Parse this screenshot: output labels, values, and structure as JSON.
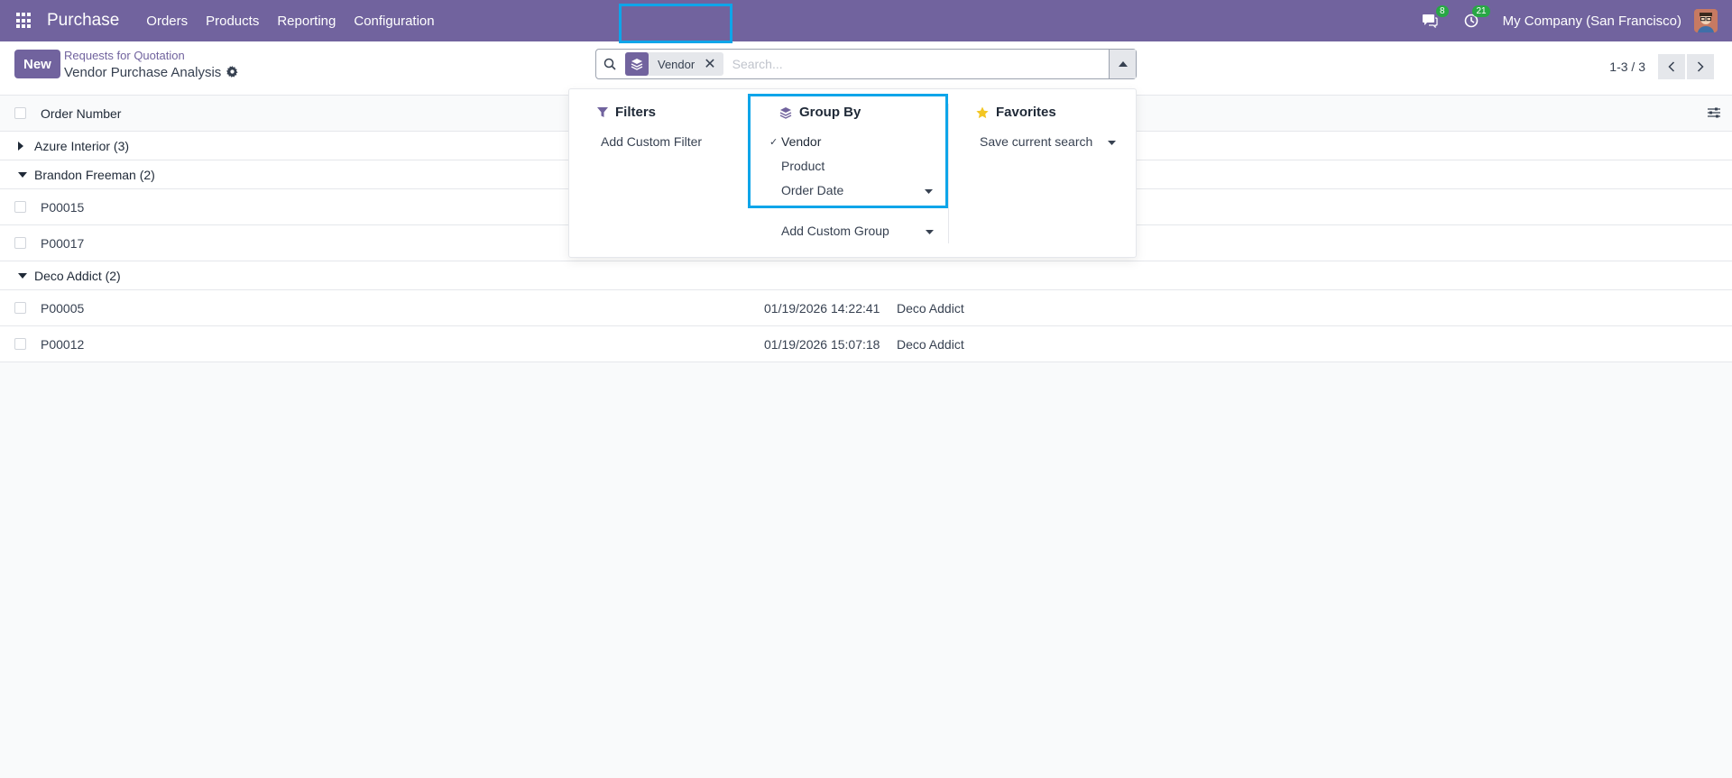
{
  "navbar": {
    "app_name": "Purchase",
    "menu": [
      "Orders",
      "Products",
      "Reporting",
      "Configuration"
    ],
    "messages_count": "8",
    "activities_count": "21",
    "company": "My Company (San Francisco)",
    "bg_color": "#71639e"
  },
  "control_panel": {
    "new_label": "New",
    "breadcrumb_parent": "Requests for Quotation",
    "breadcrumb_current": "Vendor Purchase Analysis",
    "pager_value": "1-3 / 3"
  },
  "search": {
    "facet_value": "Vendor",
    "placeholder": "Search..."
  },
  "search_panel": {
    "filters_title": "Filters",
    "add_custom_filter": "Add Custom Filter",
    "groupby_title": "Group By",
    "groupby_options": [
      {
        "label": "Vendor",
        "selected": true
      },
      {
        "label": "Product",
        "selected": false
      },
      {
        "label": "Order Date",
        "selected": false
      }
    ],
    "add_custom_group": "Add Custom Group",
    "favorites_title": "Favorites",
    "save_current_search": "Save current search"
  },
  "list": {
    "column_order_number": "Order Number",
    "groups": [
      {
        "label": "Azure Interior (3)",
        "expanded": false,
        "rows": []
      },
      {
        "label": "Brandon Freeman (2)",
        "expanded": true,
        "rows": [
          {
            "number": "P00015",
            "date": "",
            "vendor": ""
          },
          {
            "number": "P00017",
            "date": "",
            "vendor": ""
          }
        ]
      },
      {
        "label": "Deco Addict (2)",
        "expanded": true,
        "rows": [
          {
            "number": "P00005",
            "date": "01/19/2026 14:22:41",
            "vendor": "Deco Addict"
          },
          {
            "number": "P00012",
            "date": "01/19/2026 15:07:18",
            "vendor": "Deco Addict"
          }
        ]
      }
    ]
  },
  "icons": [
    "apps-icon",
    "chat-icon",
    "clock-icon",
    "avatar",
    "gear-icon",
    "search-icon",
    "layers-icon",
    "close-icon",
    "caret-up-icon",
    "chevron-left-icon",
    "chevron-right-icon",
    "sliders-icon",
    "caret-right-icon",
    "caret-down-icon",
    "filter-icon",
    "star-icon",
    "check-icon"
  ],
  "colors": {
    "accent": "#71639e",
    "highlight": "#0ea5e9",
    "badge": "#28a745",
    "star": "#f3c623"
  }
}
